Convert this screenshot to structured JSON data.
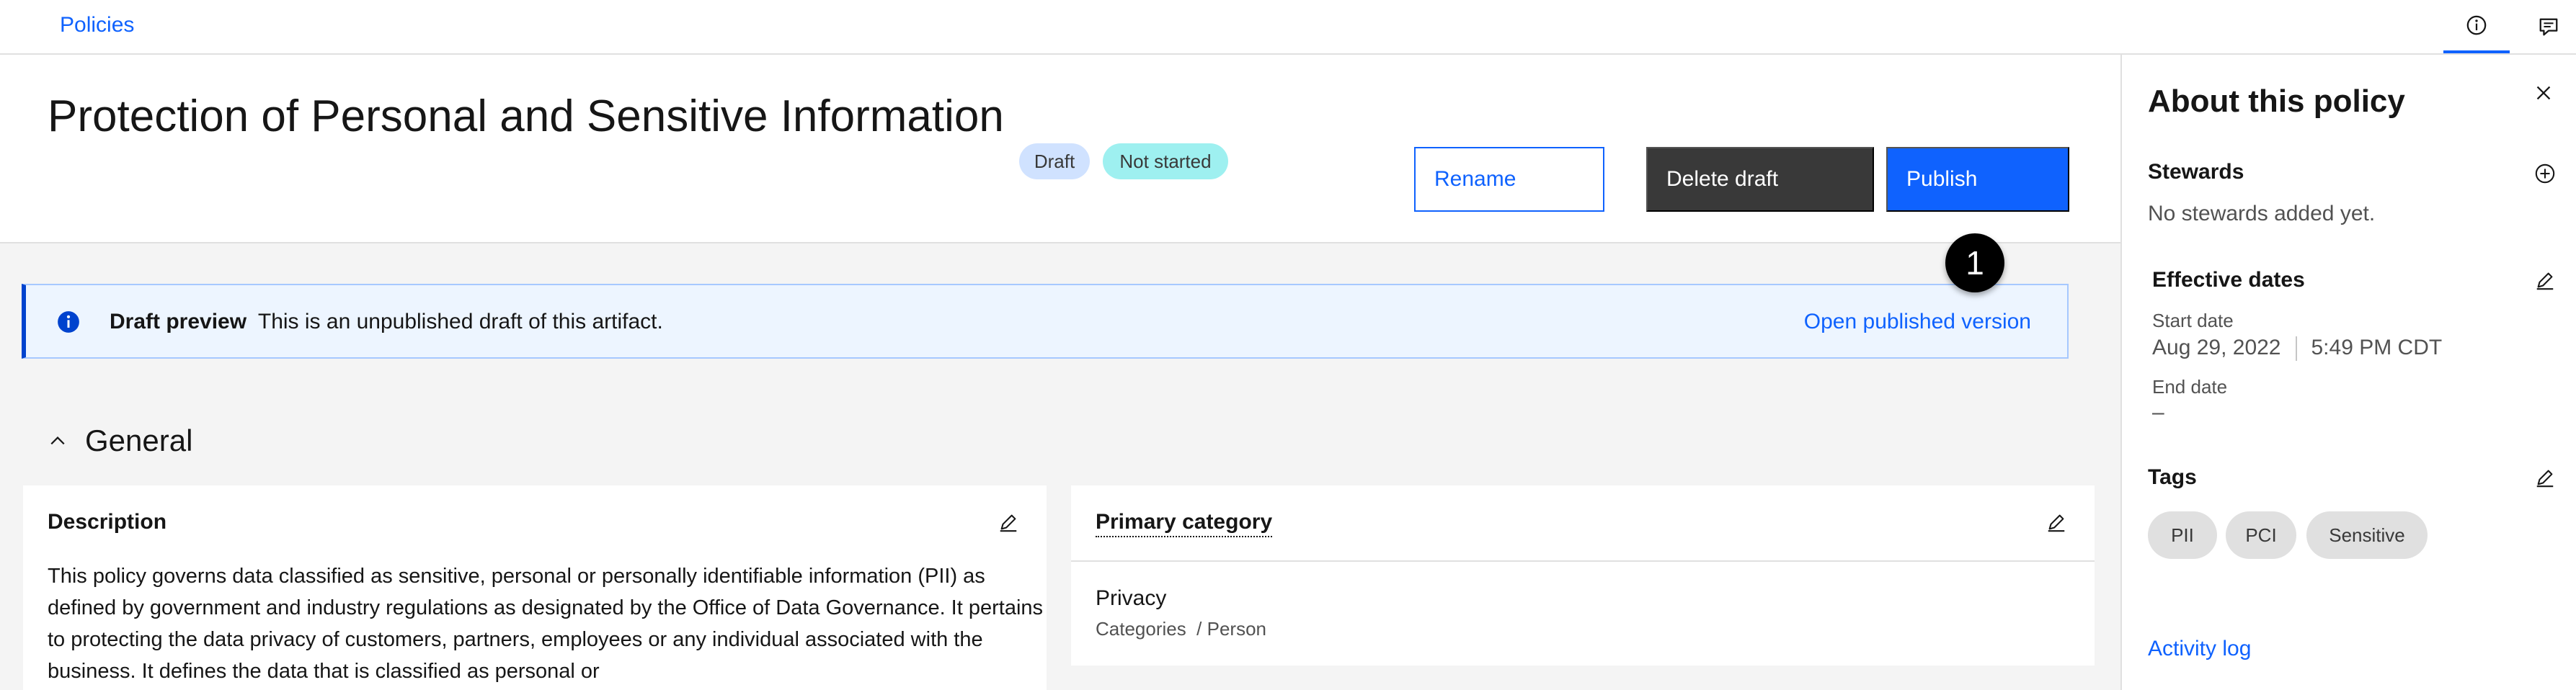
{
  "topbar": {
    "breadcrumb": "Policies",
    "info_icon": "info-icon",
    "chat_icon": "chat-icon"
  },
  "header": {
    "title": "Protection of Personal and Sensitive Information",
    "tags": [
      "Draft",
      "Not started"
    ],
    "buttons": {
      "rename": "Rename",
      "delete": "Delete draft",
      "publish": "Publish"
    },
    "step_badge": "1"
  },
  "notification": {
    "title": "Draft preview",
    "message": "This is an unpublished draft of this artifact.",
    "link": "Open published version"
  },
  "general": {
    "title": "General",
    "description": {
      "heading": "Description",
      "text": "This policy governs data classified as sensitive, personal or personally identifiable information (PII) as defined by government and industry regulations as designated by the Office of Data Governance. It pertains to protecting the data privacy of customers, partners, employees or any individual associated with the business. It defines the data that is classified as personal or"
    },
    "primary_category": {
      "heading": "Primary category",
      "name": "Privacy",
      "path": "Categories  / Person"
    }
  },
  "panel": {
    "title": "About this policy",
    "stewards": {
      "label": "Stewards",
      "empty": "No stewards added yet."
    },
    "effective_dates": {
      "label": "Effective dates",
      "start_label": "Start date",
      "start_date": "Aug 29, 2022",
      "start_time": "5:49 PM CDT",
      "end_label": "End date",
      "end_value": "–"
    },
    "tags": {
      "label": "Tags",
      "items": [
        "PII",
        "PCI",
        "Sensitive"
      ]
    },
    "activity_log": "Activity log"
  },
  "colors": {
    "accent": "#0f62fe",
    "dark_button": "#393939",
    "notification_bg": "#edf5ff",
    "draft_tag": "#d0e2ff",
    "status_tag": "#9ef0f0"
  }
}
